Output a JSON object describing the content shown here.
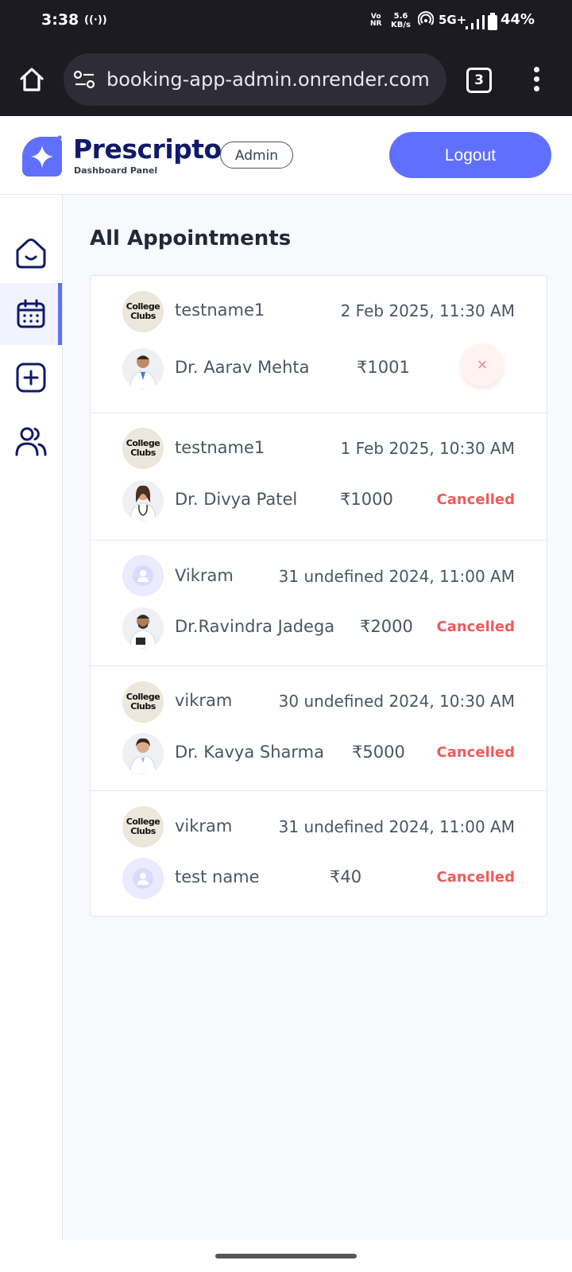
{
  "status_bar": {
    "time": "3:38",
    "volte_line1": "Vo",
    "volte_line2": "NR",
    "speed_value": "5.6",
    "speed_unit": "KB/s",
    "network": "5G+",
    "battery": "44%"
  },
  "browser": {
    "url": "booking-app-admin.onrender.com",
    "tab_count": "3"
  },
  "header": {
    "brand": "Prescripto",
    "subtitle": "Dashboard Panel",
    "role_badge": "Admin",
    "logout_label": "Logout"
  },
  "sidebar": {
    "items": [
      {
        "icon": "home-icon",
        "active": false
      },
      {
        "icon": "calendar-icon",
        "active": true
      },
      {
        "icon": "add-icon",
        "active": false
      },
      {
        "icon": "people-icon",
        "active": false
      }
    ]
  },
  "page": {
    "title": "All Appointments"
  },
  "avatar_text": {
    "line1": "College",
    "line2": "Clubs"
  },
  "appointments": [
    {
      "patient": "testname1",
      "datetime": "2 Feb 2025, 11:30 AM",
      "doctor": "Dr. Aarav Mehta",
      "fee": "₹1001",
      "status": "",
      "cancel_icon": "×"
    },
    {
      "patient": "testname1",
      "datetime": "1 Feb 2025, 10:30 AM",
      "doctor": "Dr. Divya Patel",
      "fee": "₹1000",
      "status": "Cancelled"
    },
    {
      "patient": "Vikram",
      "datetime": "31 undefined 2024, 11:00 AM",
      "doctor": "Dr.Ravindra Jadega",
      "fee": "₹2000",
      "status": "Cancelled"
    },
    {
      "patient": "vikram",
      "datetime": "30 undefined 2024, 10:30 AM",
      "doctor": "Dr. Kavya Sharma",
      "fee": "₹5000",
      "status": "Cancelled"
    },
    {
      "patient": "vikram",
      "datetime": "31 undefined 2024, 11:00 AM",
      "doctor": "test name",
      "fee": "₹40",
      "status": "Cancelled"
    }
  ],
  "colors": {
    "accent": "#5f6fff",
    "brand_text": "#0f1a6b",
    "cancelled": "#f05a5a",
    "status_bar_bg": "#1c1b22"
  }
}
